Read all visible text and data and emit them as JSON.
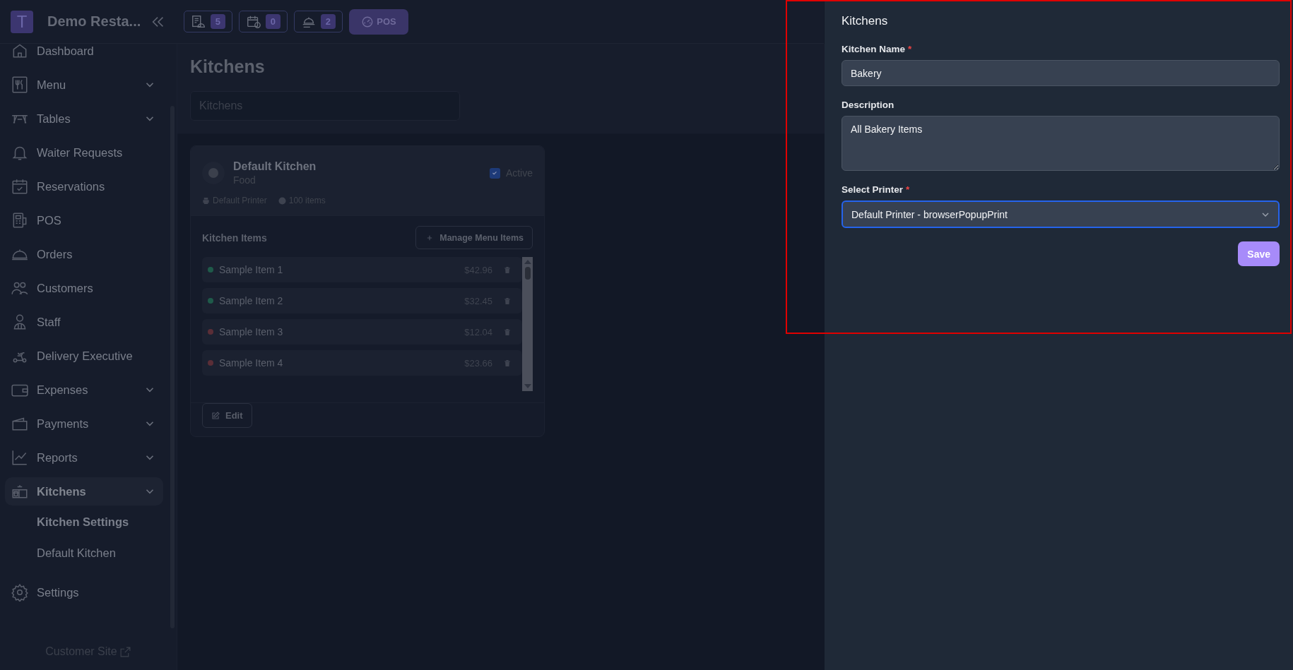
{
  "header": {
    "brand_initial": "T",
    "brand_name": "Demo Resta...",
    "counters": [
      {
        "count": "5"
      },
      {
        "count": "0"
      },
      {
        "count": "2"
      }
    ],
    "pos_button": "POS"
  },
  "sidebar": {
    "items": [
      {
        "label": "Dashboard",
        "selected": false
      },
      {
        "label": "Menu",
        "selected": false,
        "kind": "group"
      },
      {
        "label": "Tables",
        "selected": false,
        "kind": "group"
      },
      {
        "label": "Waiter Requests",
        "selected": false
      },
      {
        "label": "Reservations",
        "selected": false
      },
      {
        "label": "POS",
        "selected": false
      },
      {
        "label": "Orders",
        "selected": false
      },
      {
        "label": "Customers",
        "selected": false
      },
      {
        "label": "Staff",
        "selected": false
      },
      {
        "label": "Delivery Executive",
        "selected": false
      },
      {
        "label": "Expenses",
        "selected": false,
        "kind": "group"
      },
      {
        "label": "Payments",
        "selected": false,
        "kind": "group"
      },
      {
        "label": "Reports",
        "selected": false,
        "kind": "group"
      },
      {
        "label": "Kitchens",
        "selected": true,
        "kind": "group",
        "children": [
          {
            "label": "Kitchen Settings",
            "selected": true
          },
          {
            "label": "Default Kitchen",
            "selected": false
          }
        ]
      },
      {
        "label": "Settings",
        "selected": false
      }
    ],
    "footer_link": "Customer Site"
  },
  "page": {
    "title": "Kitchens",
    "search": {
      "placeholder": "Kitchens"
    },
    "kitchen_card": {
      "name": "Default Kitchen",
      "type": "Food",
      "active": {
        "label": "Active",
        "checked": true
      },
      "printer": "Default Printer",
      "item_count": "100 items",
      "items_title": "Kitchen Items",
      "manage_button": "Manage Menu Items",
      "items": [
        {
          "name": "Sample Item 1",
          "price": "$42.96",
          "available": true
        },
        {
          "name": "Sample Item 2",
          "price": "$32.45",
          "available": true
        },
        {
          "name": "Sample Item 3",
          "price": "$12.04",
          "available": false
        },
        {
          "name": "Sample Item 4",
          "price": "$23.66",
          "available": false
        }
      ],
      "edit_button": "Edit"
    }
  },
  "panel": {
    "title": "Kitchens",
    "fields": [
      {
        "kind": "text",
        "label": "Kitchen Name",
        "required_mark": "*",
        "value": "Bakery"
      },
      {
        "kind": "textarea",
        "label": "Description",
        "value": "All Bakery Items"
      },
      {
        "kind": "select",
        "label": "Select Printer",
        "required_mark": "*",
        "value": "Default Printer - browserPopupPrint",
        "focused": true
      }
    ],
    "save_button": "Save"
  }
}
